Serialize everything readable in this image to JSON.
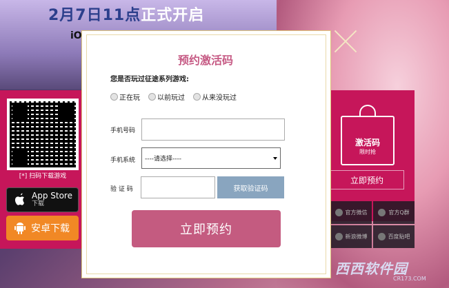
{
  "background": {
    "banner_prefix": "2月7日11点",
    "banner_highlight": "正式开启",
    "ios_fragment": "iO",
    "qr_caption": "[*] 扫码下载游戏",
    "appstore": {
      "title": "App Store",
      "subtitle": "下载"
    },
    "android_label": "安卓下载",
    "gift": {
      "title": "激活码",
      "subtitle": "限时抢"
    },
    "reserve_small": "立即预约",
    "social": [
      "官方微信",
      "官方Q群",
      "新浪微博",
      "百度贴吧"
    ],
    "watermark": "西西软件园",
    "watermark_sub": "CR173.COM"
  },
  "modal": {
    "title": "预约激活码",
    "question": "您是否玩过征途系列游戏:",
    "radio_options": [
      "正在玩",
      "以前玩过",
      "从来没玩过"
    ],
    "phone_label": "手机号码",
    "phone_value": "",
    "system_label": "手机系统",
    "system_selected": "----请选择----",
    "code_label": "验 证 码",
    "code_value": "",
    "get_code_button": "获取验证码",
    "submit_button": "立即预约"
  },
  "colors": {
    "accent": "#c45b80",
    "panel_pink": "#c6165a",
    "get_code_bg": "#89a5bf"
  }
}
